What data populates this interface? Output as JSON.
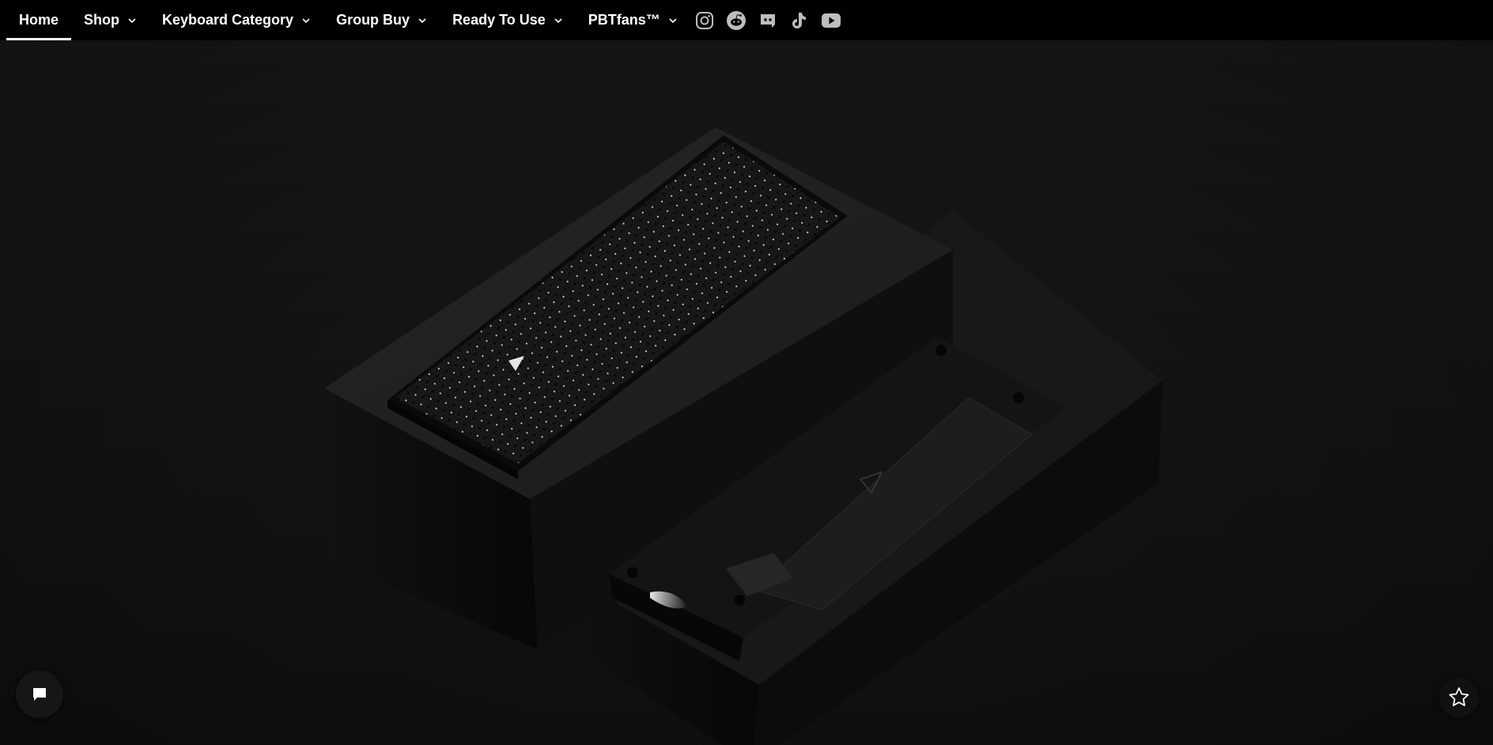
{
  "nav": {
    "items": [
      {
        "label": "Home",
        "active": true,
        "dropdown": false
      },
      {
        "label": "Shop",
        "active": false,
        "dropdown": true
      },
      {
        "label": "Keyboard Category",
        "active": false,
        "dropdown": true
      },
      {
        "label": "Group Buy",
        "active": false,
        "dropdown": true
      },
      {
        "label": "Ready To Use",
        "active": false,
        "dropdown": true
      },
      {
        "label": "PBTfans™",
        "active": false,
        "dropdown": true
      }
    ],
    "social_icons": [
      "instagram-icon",
      "reddit-icon",
      "discord-icon",
      "tiktok-icon",
      "youtube-icon"
    ]
  },
  "colors": {
    "nav_background": "#000000",
    "nav_text": "#ffffff",
    "hero_background": "#141414",
    "social_icon": "#bdbdbd"
  },
  "widgets": {
    "chat_icon": "chat-bubble-icon",
    "rewards_icon": "star-badge-icon"
  }
}
